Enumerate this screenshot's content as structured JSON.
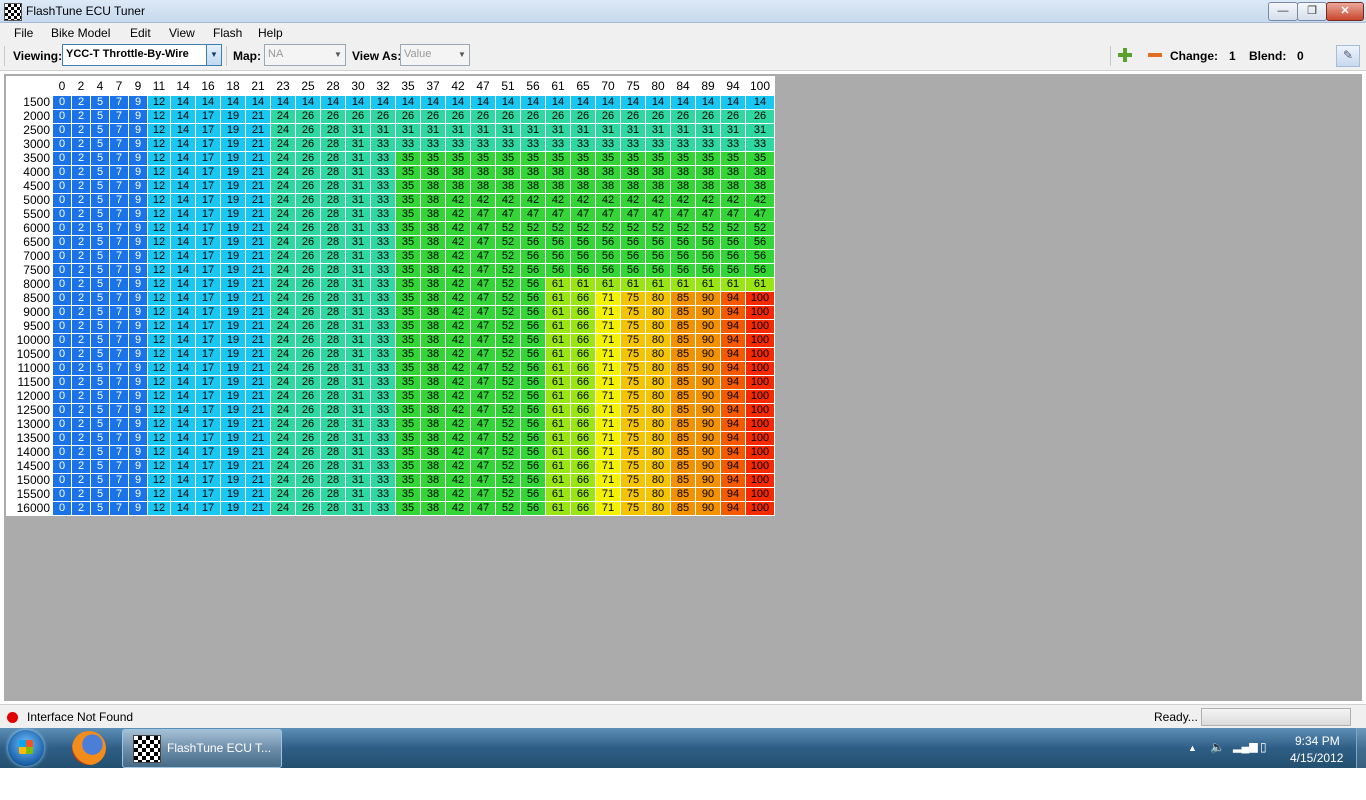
{
  "window": {
    "title": "FlashTune ECU Tuner",
    "min": "—",
    "max": "❐",
    "close": "✕"
  },
  "menu": [
    "File",
    "Bike Model",
    "Edit",
    "View",
    "Flash",
    "Help"
  ],
  "toolbar": {
    "viewing_label": "Viewing:",
    "viewing_value": "YCC-T Throttle-By-Wire",
    "map_label": "Map:",
    "map_value": "NA",
    "view_as_label": "View As:",
    "view_as_value": "Value",
    "change_label": "Change:",
    "change_value": "1",
    "blend_label": "Blend:",
    "blend_value": "0"
  },
  "colors": {
    "c_blue": "#1a73e8",
    "c_cyan": "#18c8f2",
    "c_teal": "#2ed8a0",
    "c_green": "#33d636",
    "c_lime": "#9ae615",
    "c_yellow": "#f2f200",
    "c_amber": "#f5c400",
    "c_orange": "#f29200",
    "c_redorange": "#f55a00",
    "c_red": "#f52a00"
  },
  "table": {
    "columns": [
      "0",
      "2",
      "4",
      "7",
      "9",
      "11",
      "14",
      "16",
      "18",
      "21",
      "23",
      "25",
      "28",
      "30",
      "32",
      "35",
      "37",
      "42",
      "47",
      "51",
      "56",
      "61",
      "65",
      "70",
      "75",
      "80",
      "84",
      "89",
      "94",
      "100"
    ],
    "rows": [
      "1500",
      "2000",
      "2500",
      "3000",
      "3500",
      "4000",
      "4500",
      "5000",
      "5500",
      "6000",
      "6500",
      "7000",
      "7500",
      "8000",
      "8500",
      "9000",
      "9500",
      "10000",
      "10500",
      "11000",
      "11500",
      "12000",
      "12500",
      "13000",
      "13500",
      "14000",
      "14500",
      "15000",
      "15500",
      "16000"
    ],
    "caps": [
      14,
      26,
      31,
      33,
      35,
      38,
      38,
      42,
      47,
      52,
      56,
      56,
      56,
      61,
      100,
      100,
      100,
      100,
      100,
      100,
      100,
      100,
      100,
      100,
      100,
      100,
      100,
      100,
      100,
      100
    ],
    "base": [
      0,
      2,
      5,
      7,
      9,
      12,
      14,
      17,
      19,
      21,
      24,
      26,
      28,
      31,
      33,
      35,
      38,
      42,
      47,
      52,
      56,
      61,
      66,
      71,
      75,
      80,
      85,
      90,
      94,
      100
    ]
  },
  "status": {
    "interface": "Interface Not Found",
    "ready": "Ready..."
  },
  "taskbar": {
    "app_label": "FlashTune ECU T...",
    "time": "9:34 PM",
    "date": "4/15/2012"
  }
}
